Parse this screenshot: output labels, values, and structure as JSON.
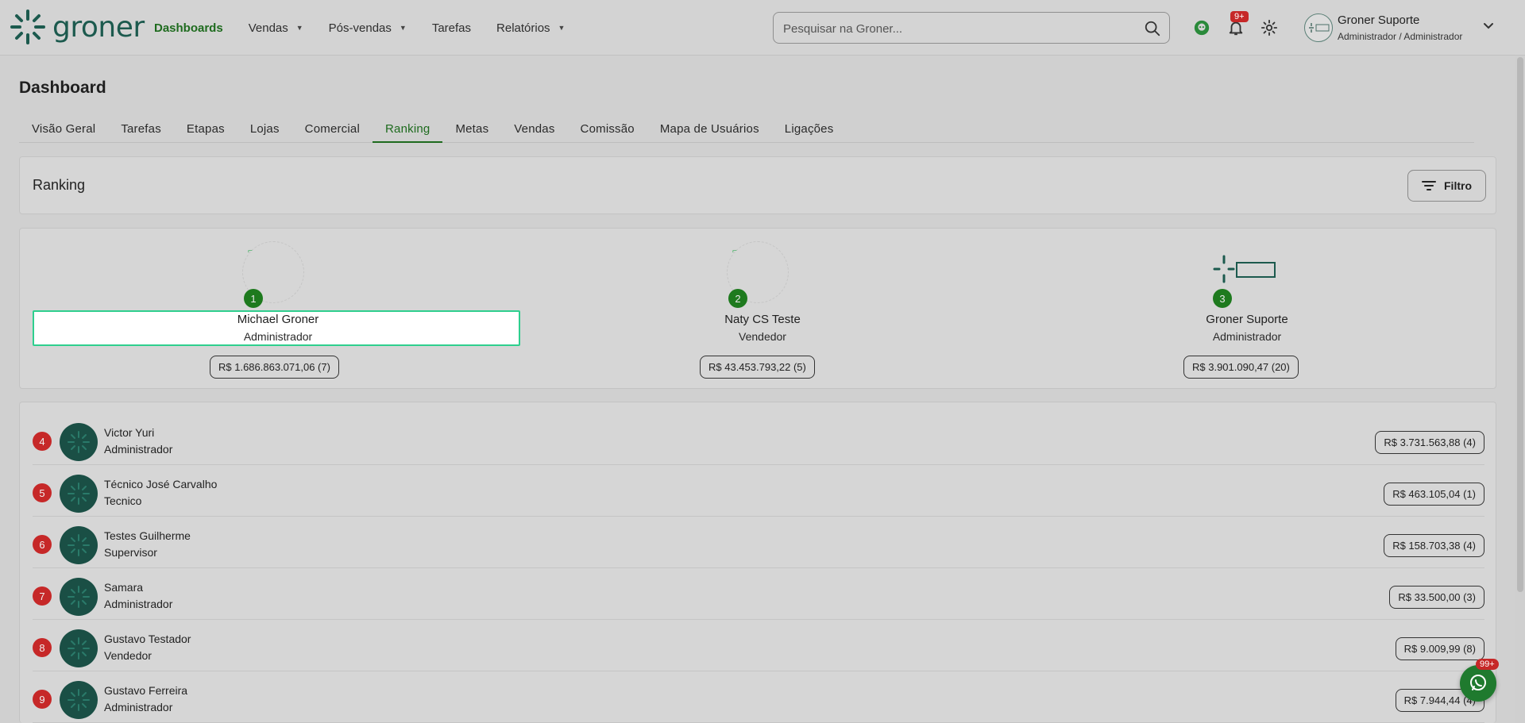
{
  "app": {
    "logo_text": "groner",
    "nav": [
      {
        "label": "Dashboards",
        "active": true,
        "dropdown": false
      },
      {
        "label": "Vendas",
        "active": false,
        "dropdown": true
      },
      {
        "label": "Pós-vendas",
        "active": false,
        "dropdown": true
      },
      {
        "label": "Tarefas",
        "active": false,
        "dropdown": false
      },
      {
        "label": "Relatórios",
        "active": false,
        "dropdown": true
      }
    ],
    "search": {
      "placeholder": "Pesquisar na Groner...",
      "value": ""
    },
    "notifications_badge": "9+",
    "user": {
      "name": "Groner Suporte",
      "role": "Administrador / Administrador"
    }
  },
  "page": {
    "title": "Dashboard",
    "tabs": [
      {
        "label": "Visão Geral",
        "active": false
      },
      {
        "label": "Tarefas",
        "active": false
      },
      {
        "label": "Etapas",
        "active": false
      },
      {
        "label": "Lojas",
        "active": false
      },
      {
        "label": "Comercial",
        "active": false
      },
      {
        "label": "Ranking",
        "active": true
      },
      {
        "label": "Metas",
        "active": false
      },
      {
        "label": "Vendas",
        "active": false
      },
      {
        "label": "Comissão",
        "active": false
      },
      {
        "label": "Mapa de Usuários",
        "active": false
      },
      {
        "label": "Ligações",
        "active": false
      }
    ]
  },
  "ranking": {
    "title": "Ranking",
    "filter_label": "Filtro",
    "podium": [
      {
        "position": "1",
        "name": "Michael Groner",
        "role": "Administrador",
        "value": "R$ 1.686.863.071,06 (7)"
      },
      {
        "position": "2",
        "name": "Naty CS Teste",
        "role": "Vendedor",
        "value": "R$ 43.453.793,22 (5)"
      },
      {
        "position": "3",
        "name": "Groner Suporte",
        "role": "Administrador",
        "value": "R$ 3.901.090,47 (20)"
      }
    ],
    "list": [
      {
        "position": "4",
        "name": "Victor Yuri",
        "role": "Administrador",
        "value": "R$ 3.731.563,88 (4)"
      },
      {
        "position": "5",
        "name": "Técnico José Carvalho",
        "role": "Tecnico",
        "value": "R$ 463.105,04 (1)"
      },
      {
        "position": "6",
        "name": "Testes Guilherme",
        "role": "Supervisor",
        "value": "R$ 158.703,38 (4)"
      },
      {
        "position": "7",
        "name": "Samara",
        "role": "Administrador",
        "value": "R$ 33.500,00 (3)"
      },
      {
        "position": "8",
        "name": "Gustavo Testador",
        "role": "Vendedor",
        "value": "R$ 9.009,99 (8)"
      },
      {
        "position": "9",
        "name": "Gustavo Ferreira",
        "role": "Administrador",
        "value": "R$ 7.944,44 (4)"
      }
    ]
  },
  "whatsapp_badge": "99+",
  "colors": {
    "brand": "#1c5a4e",
    "accent": "#1e6b1e",
    "badge": "#c62828"
  }
}
